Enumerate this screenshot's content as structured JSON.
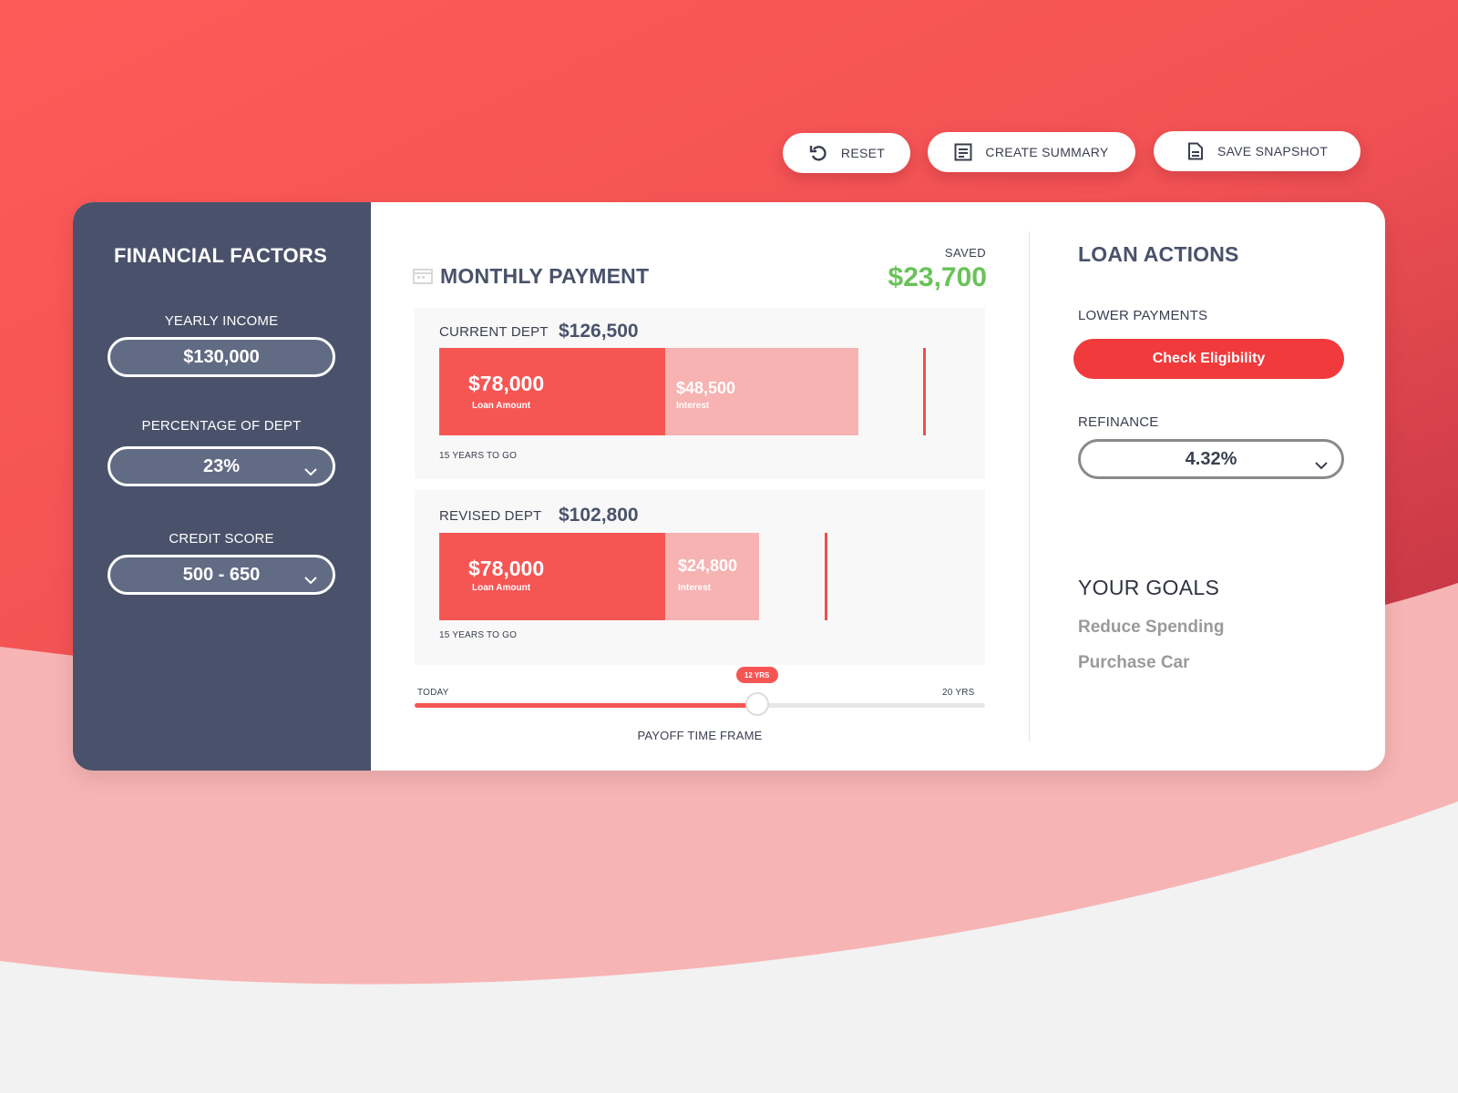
{
  "toolbar": {
    "reset_label": "RESET",
    "summary_label": "CREATE SUMMARY",
    "snapshot_label": "SAVE SNAPSHOT"
  },
  "financial_factors": {
    "title": "FINANCIAL FACTORS",
    "yearly_income": {
      "label": "YEARLY INCOME",
      "value": "$130,000"
    },
    "percentage_of_dept": {
      "label": "PERCENTAGE OF DEPT",
      "value": "23%"
    },
    "credit_score": {
      "label": "CREDIT SCORE",
      "value": "500 - 650"
    }
  },
  "monthly_payment": {
    "title": "MONTHLY PAYMENT",
    "saved_label": "SAVED",
    "saved_value": "$23,700",
    "current": {
      "label": "CURRENT DEPT",
      "amount": "$126,500",
      "loan_value": "$78,000",
      "loan_label": "Loan Amount",
      "interest_value": "$48,500",
      "interest_label": "Interest",
      "years_label": "15 YEARS TO GO"
    },
    "revised": {
      "label": "REVISED DEPT",
      "amount": "$102,800",
      "loan_value": "$78,000",
      "loan_label": "Loan Amount",
      "interest_value": "$24,800",
      "interest_label": "Interest",
      "years_label": "15 YEARS TO GO"
    },
    "slider": {
      "start_label": "TODAY",
      "end_label": "20 YRS",
      "value_label": "12 YRS",
      "value_years": 12,
      "max_years": 20,
      "caption": "PAYOFF TIME FRAME"
    }
  },
  "loan_actions": {
    "title": "LOAN ACTIONS",
    "lower_payments_label": "LOWER PAYMENTS",
    "check_button": "Check Eligibility",
    "refinance_label": "REFINANCE",
    "refinance_value": "4.32%"
  },
  "goals": {
    "title": "YOUR GOALS",
    "items": [
      "Reduce Spending",
      "Purchase Car"
    ]
  },
  "colors": {
    "accent_red": "#f55654",
    "interest_pink": "#f7b2b2",
    "panel_navy": "#4a526b",
    "saved_green": "#6ac259"
  }
}
